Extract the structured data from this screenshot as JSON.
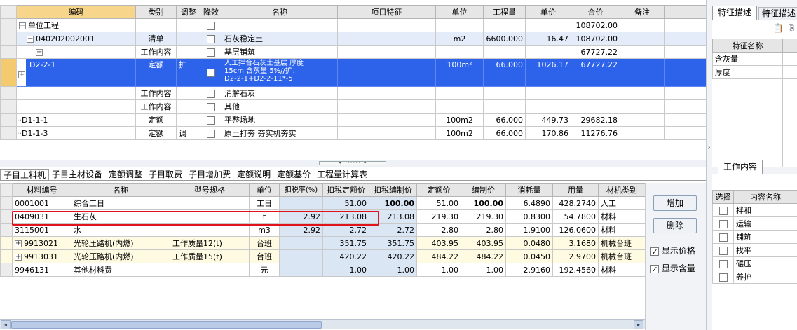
{
  "upper": {
    "headers": [
      "编码",
      "类别",
      "调整",
      "降效",
      "名称",
      "项目特征",
      "单位",
      "工程量",
      "单价",
      "合价",
      "备注"
    ],
    "rows": [
      {
        "code": "单位工程",
        "type": "",
        "adjust": "",
        "name": "",
        "feature": "",
        "unit": "",
        "qty": "",
        "price": "",
        "total": "108702.00",
        "remark": "",
        "indent": 0,
        "tree": "−"
      },
      {
        "code": "040202002001",
        "type": "清单",
        "adjust": "",
        "name": "石灰稳定土",
        "feature": "",
        "unit": "m2",
        "qty": "6600.000",
        "price": "16.47",
        "total": "108702.00",
        "remark": "",
        "indent": 1,
        "tree": "−"
      },
      {
        "code": "",
        "type": "工作内容",
        "adjust": "",
        "name": "基层铺筑",
        "feature": "",
        "unit": "",
        "qty": "",
        "price": "",
        "total": "67727.22",
        "remark": "",
        "indent": 2,
        "tree": "−"
      },
      {
        "code": "D2-2-1",
        "type": "定额",
        "adjust": "扩",
        "name_lines": [
          "人工拌合石灰土基层 厚度",
          "15cm 含灰量 5%//扩：",
          "D2-2-1+D2-2-11*-5"
        ],
        "feature": "",
        "unit": "100m²",
        "qty": "66.000",
        "price": "1026.17",
        "total": "67727.22",
        "remark": "",
        "indent": 3,
        "tree": "+"
      },
      {
        "code": "",
        "type": "工作内容",
        "adjust": "",
        "name": "消解石灰",
        "feature": "",
        "unit": "",
        "qty": "",
        "price": "",
        "total": "",
        "remark": ""
      },
      {
        "code": "",
        "type": "工作内容",
        "adjust": "",
        "name": "其他",
        "feature": "",
        "unit": "",
        "qty": "",
        "price": "",
        "total": "",
        "remark": ""
      },
      {
        "code": "D1-1-1",
        "type": "定额",
        "adjust": "",
        "name": "平整场地",
        "feature": "",
        "unit": "100m2",
        "qty": "66.000",
        "price": "449.73",
        "total": "29682.18",
        "remark": ""
      },
      {
        "code": "D1-1-3",
        "type": "定额",
        "adjust": "调",
        "name": "原土打夯 夯实机夯实",
        "feature": "",
        "unit": "100m2",
        "qty": "66.000",
        "price": "170.86",
        "total": "11276.76",
        "remark": ""
      }
    ]
  },
  "right_top": {
    "tabs": [
      "特征描述",
      "特征描述"
    ],
    "header": "特征名称",
    "rows": [
      "含灰量",
      "厚度"
    ]
  },
  "lower_tabs": [
    "子目工料机",
    "子目主材设备",
    "定额调整",
    "子目取费",
    "子目增加费",
    "定额说明",
    "定额基价",
    "工程量计算表"
  ],
  "lower": {
    "headers": [
      "材料编号",
      "名称",
      "型号规格",
      "单位",
      "扣税率(%)",
      "扣税定额价",
      "扣税编制价",
      "定额价",
      "编制价",
      "消耗量",
      "用量",
      "材机类别"
    ],
    "rows": [
      {
        "code": "0001001",
        "name": "综合工日",
        "spec": "",
        "unit": "工日",
        "rate": "",
        "tax_quota": "51.00",
        "tax_comp": "100.00",
        "quota": "51.00",
        "comp": "100.00",
        "consume": "6.4890",
        "usage": "428.2740",
        "cat": "人工",
        "tree": false,
        "bold_comp": true
      },
      {
        "code": "0409031",
        "name": "生石灰",
        "spec": "",
        "unit": "t",
        "rate": "2.92",
        "tax_quota": "213.08",
        "tax_comp": "213.08",
        "quota": "219.30",
        "comp": "219.30",
        "consume": "0.8300",
        "usage": "54.7800",
        "cat": "材料",
        "tree": false
      },
      {
        "code": "3115001",
        "name": "水",
        "spec": "",
        "unit": "m3",
        "rate": "2.92",
        "tax_quota": "2.72",
        "tax_comp": "2.72",
        "quota": "2.80",
        "comp": "2.80",
        "consume": "1.9100",
        "usage": "126.0600",
        "cat": "材料",
        "tree": false
      },
      {
        "code": "9913021",
        "name": "光轮压路机(内燃)",
        "spec": "工作质量12(t)",
        "unit": "台班",
        "rate": "",
        "tax_quota": "351.75",
        "tax_comp": "351.75",
        "quota": "403.95",
        "comp": "403.95",
        "consume": "0.0480",
        "usage": "3.1680",
        "cat": "机械台班",
        "tree": true
      },
      {
        "code": "9913031",
        "name": "光轮压路机(内燃)",
        "spec": "工作质量15(t)",
        "unit": "台班",
        "rate": "",
        "tax_quota": "420.22",
        "tax_comp": "420.22",
        "quota": "484.22",
        "comp": "484.22",
        "consume": "0.0450",
        "usage": "2.9700",
        "cat": "机械台班",
        "tree": true
      },
      {
        "code": "9946131",
        "name": "其他材料费",
        "spec": "",
        "unit": "元",
        "rate": "",
        "tax_quota": "1.00",
        "tax_comp": "1.00",
        "quota": "1.00",
        "comp": "1.00",
        "consume": "2.9160",
        "usage": "192.4560",
        "cat": "材料",
        "tree": false
      }
    ]
  },
  "side_buttons": {
    "add": "增加",
    "delete": "删除"
  },
  "checkboxes": {
    "show_price": "显示价格",
    "show_amount": "显示含量"
  },
  "right_bottom": {
    "tab": "工作内容",
    "headers": [
      "选择",
      "内容名称"
    ],
    "items": [
      "拌和",
      "运输",
      "铺筑",
      "找平",
      "碾压",
      "养护"
    ]
  },
  "colors": {
    "selection": "#2d63ea",
    "highlight_box": "#e0121b",
    "accent_row": "#f3ca6e"
  }
}
